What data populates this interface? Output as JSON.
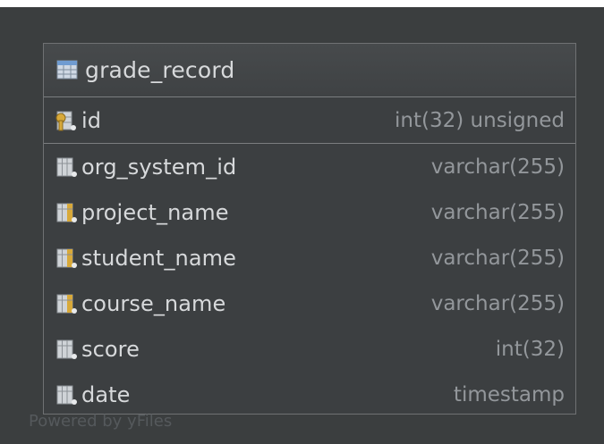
{
  "table": {
    "name": "grade_record",
    "primary_key": {
      "name": "id",
      "type": "int(32) unsigned"
    },
    "columns": [
      {
        "name": "org_system_id",
        "type": "varchar(255)",
        "icon": "column-icon"
      },
      {
        "name": "project_name",
        "type": "varchar(255)",
        "icon": "column-index-icon"
      },
      {
        "name": "student_name",
        "type": "varchar(255)",
        "icon": "column-index-icon"
      },
      {
        "name": "course_name",
        "type": "varchar(255)",
        "icon": "column-index-icon"
      },
      {
        "name": "score",
        "type": "int(32)",
        "icon": "column-icon"
      },
      {
        "name": "date",
        "type": "timestamp",
        "icon": "column-icon"
      }
    ]
  },
  "watermark": "Powered by yFiles",
  "colors": {
    "background": "#3b3e3f",
    "border": "#6f7173",
    "text": "#d7d9db",
    "type_text": "#93979b",
    "key_gold": "#d8a93a",
    "table_blue": "#6f9bd1"
  }
}
